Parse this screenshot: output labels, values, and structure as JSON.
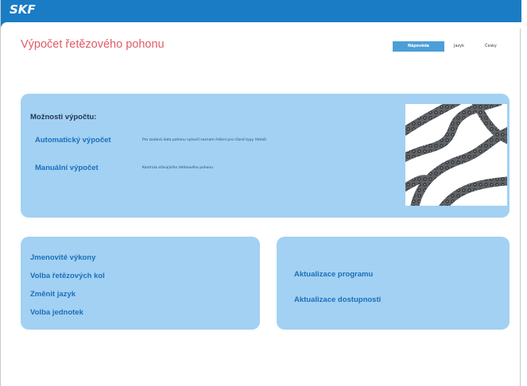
{
  "brand": {
    "logo_text": "SKF",
    "bar_color": "#1a7cc4"
  },
  "header": {
    "title": "Výpočet řetězového pohonu",
    "nav": {
      "help_label": "Nápověda",
      "language_label": "Jazyk",
      "czech_label": "Česky"
    }
  },
  "calculation_panel": {
    "title": "Možnosti výpočtu:",
    "automatic_label": "Automatický výpočet",
    "automatic_description": "Pro zadaná data pohonu vytvoří seznam řešení pro různé typy řetězů",
    "manual_label": "Manuální výpočet",
    "manual_description": "Kontrola stávajícího řetězového pohonu",
    "image": "roller-chain-photo"
  },
  "settings_panel": {
    "items": [
      {
        "label": "Jmenovité výkony"
      },
      {
        "label": "Volba řetězových kol"
      },
      {
        "label": "Změnit jazyk"
      },
      {
        "label": "Volba jednotek"
      }
    ]
  },
  "update_panel": {
    "items": [
      {
        "label": "Aktualizace programu"
      },
      {
        "label": "Aktualizace dostupnosti"
      }
    ]
  },
  "colors": {
    "panel": "#a3d1f3",
    "link": "#1a6fba",
    "title": "#e05a67"
  }
}
